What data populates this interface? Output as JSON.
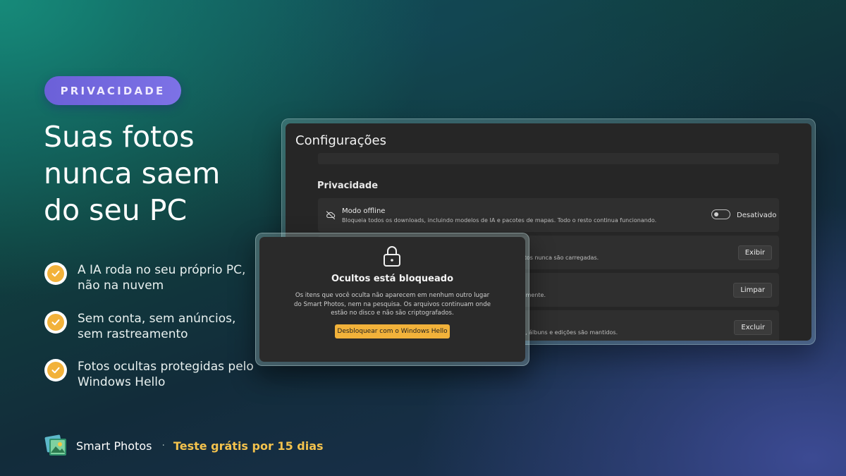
{
  "badge": "PRIVACIDADE",
  "headline": "Suas fotos\nnunca saem\ndo seu PC",
  "features": [
    "A IA roda no seu próprio PC,\nnão na nuvem",
    "Sem conta, sem anúncios,\nsem rastreamento",
    "Fotos ocultas protegidas pelo\nWindows Hello"
  ],
  "brand": {
    "name": "Smart Photos",
    "separator": "·",
    "trial": "Teste grátis por 15 dias"
  },
  "settings": {
    "title": "Configurações",
    "section": "Privacidade",
    "rows": [
      {
        "title": "Modo offline",
        "description": "Bloqueia todos os downloads, incluindo modelos de IA e pacotes de mapas. Todo o resto continua funcionando.",
        "toggle_state": "Desativado",
        "icon": "cloud-off-icon"
      },
      {
        "description_visible": "fotos nunca são carregadas.",
        "button": "Exibir"
      },
      {
        "description_visible": "vamente.",
        "button": "Limpar"
      },
      {
        "description_visible": "os, álbuns e edições são mantidos.",
        "button": "Excluir"
      }
    ]
  },
  "dialog": {
    "icon": "lock-icon",
    "title": "Ocultos está bloqueado",
    "body": "Os itens que você oculta não aparecem em nenhum outro lugar\ndo Smart Photos, nem na pesquisa. Os arquivos continuam onde\nestão no disco e não são criptografados.",
    "button": "Desbloquear com o Windows Hello"
  },
  "colors": {
    "accent": "#f2b23a",
    "badge": "#7268e0",
    "trial_text": "#f3c24d",
    "window_bg": "#262626"
  }
}
